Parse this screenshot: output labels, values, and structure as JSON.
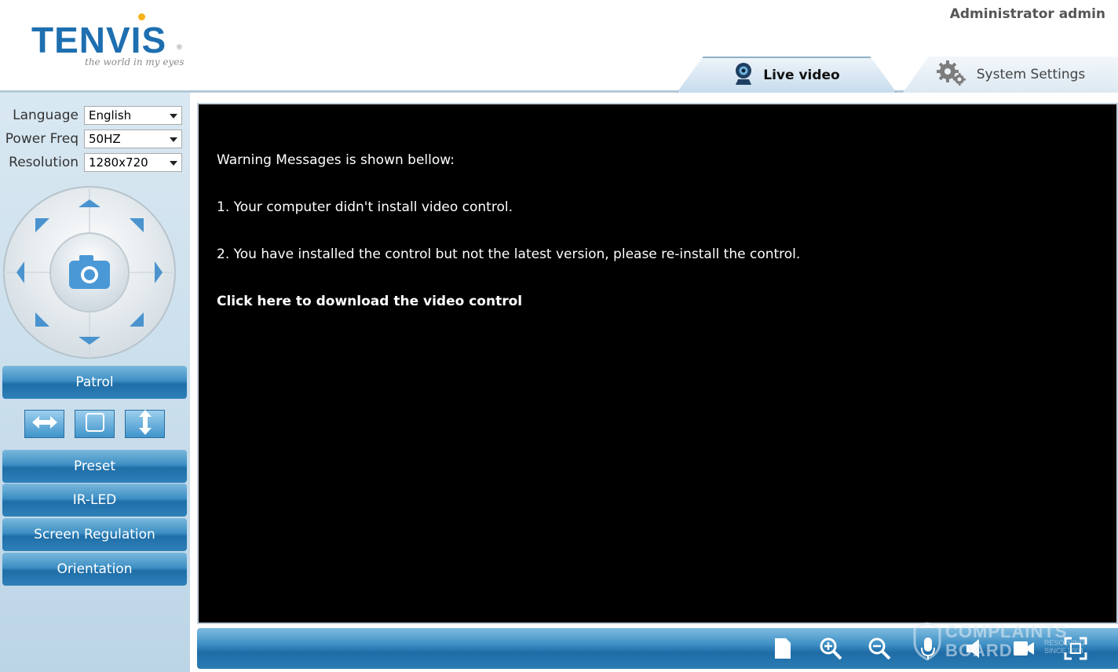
{
  "header": {
    "logo": {
      "brand": "TENVIS",
      "registered": "®",
      "tagline": "the world in my eyes"
    },
    "user": "Administrator admin",
    "tabs": [
      {
        "label": "Live video",
        "icon": "webcam-icon",
        "active": true
      },
      {
        "label": "System Settings",
        "icon": "gear-icon",
        "active": false
      }
    ]
  },
  "settings": {
    "language": {
      "label": "Language",
      "value": "English"
    },
    "power_freq": {
      "label": "Power Freq",
      "value": "50HZ"
    },
    "resolution": {
      "label": "Resolution",
      "value": "1280x720"
    }
  },
  "ptz": {
    "icons": [
      "arrow-up-icon",
      "arrow-down-icon",
      "arrow-left-icon",
      "arrow-right-icon",
      "arrow-up-left-icon",
      "arrow-up-right-icon",
      "arrow-down-left-icon",
      "arrow-down-right-icon",
      "camera-icon"
    ]
  },
  "panel": {
    "patrol": "Patrol",
    "patrol_icons": [
      "horizontal-patrol-icon",
      "stop-patrol-icon",
      "vertical-patrol-icon"
    ],
    "preset": "Preset",
    "ir_led": "IR-LED",
    "screen_regulation": "Screen Regulation",
    "orientation": "Orientation"
  },
  "video": {
    "warning_title": "Warning Messages is shown bellow:",
    "message_1": "1. Your computer didn't install video control.",
    "message_2": "2. You have installed the control but not the latest version, please re-install the control.",
    "download_link": "Click here to download the video control"
  },
  "toolbar": {
    "icons": [
      "snapshot-icon",
      "zoom-in-icon",
      "zoom-out-icon",
      "microphone-icon",
      "speaker-icon",
      "record-icon",
      "fullscreen-icon"
    ]
  },
  "watermark": {
    "line1": "COMPLAINTS",
    "line2": "BOARD",
    "line3": "RESOLVING SINCE 2004"
  },
  "colors": {
    "accent": "#1e6fb0",
    "button": "#2f80b8",
    "panel": "#cfe1ee",
    "logo_dot": "#f5b21c"
  }
}
